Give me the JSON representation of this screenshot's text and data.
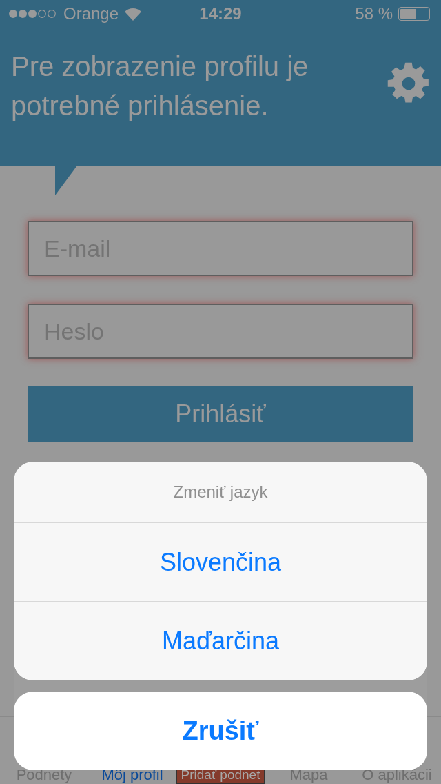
{
  "status_bar": {
    "carrier": "Orange",
    "time": "14:29",
    "battery": "58 %"
  },
  "header": {
    "message": "Pre zobrazenie profilu je potrebné prihlásenie."
  },
  "form": {
    "fields": [
      {
        "placeholder": "E-mail"
      },
      {
        "placeholder": "Heslo"
      }
    ],
    "submit": "Prihlásiť"
  },
  "tab_bar": [
    {
      "label": "Podnety",
      "selected": false,
      "kind": "tab"
    },
    {
      "label": "Môj profil",
      "selected": true,
      "kind": "tab"
    },
    {
      "label": "Pridať podnet",
      "kind": "action"
    },
    {
      "label": "Mapa",
      "selected": false,
      "kind": "tab"
    },
    {
      "label": "O aplikácii",
      "selected": false,
      "kind": "tab"
    }
  ],
  "action_sheet": {
    "title": "Zmeniť jazyk",
    "options": [
      "Slovenčina",
      "Maďarčina"
    ],
    "cancel": "Zrušiť"
  }
}
